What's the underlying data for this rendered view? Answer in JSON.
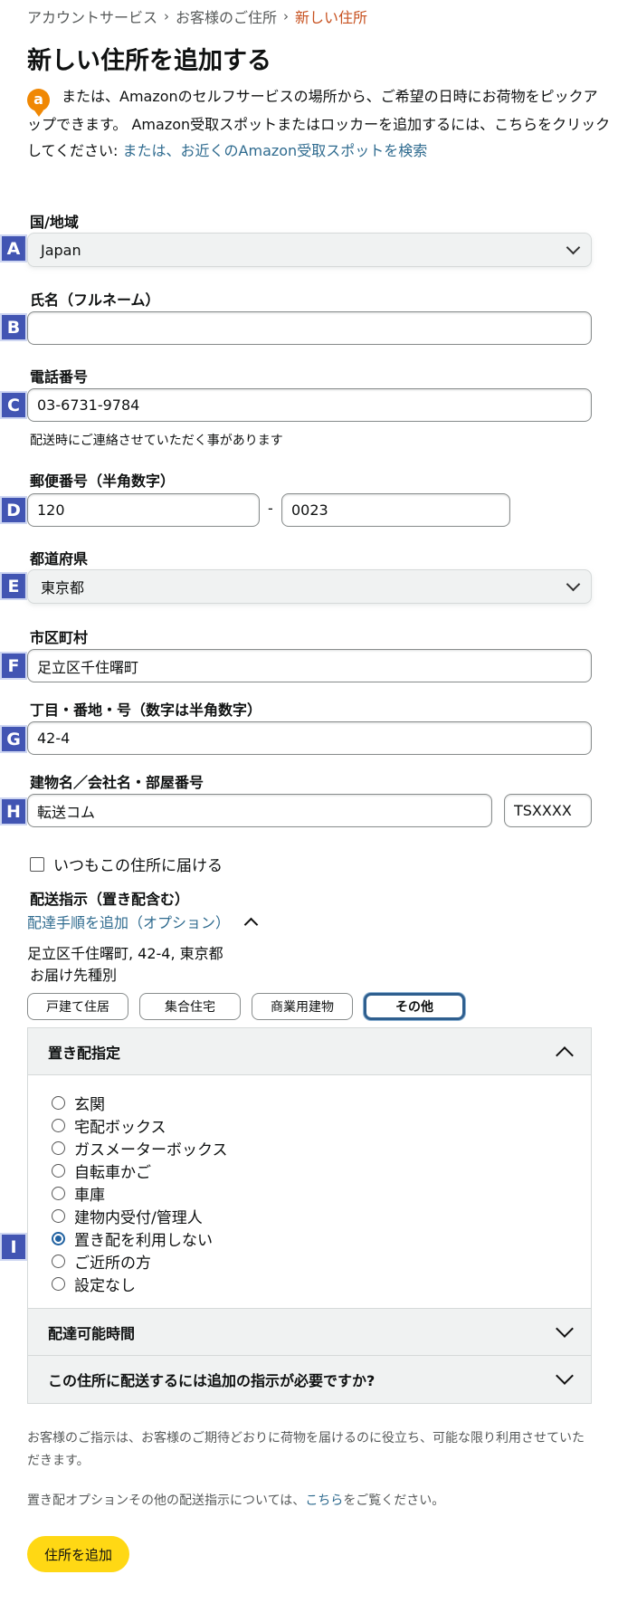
{
  "breadcrumb": {
    "item1": "アカウントサービス",
    "item2": "お客様のご住所",
    "current": "新しい住所",
    "sep": "›"
  },
  "title": "新しい住所を追加する",
  "info": {
    "badge": "a",
    "text": "または、Amazonのセルフサービスの場所から、ご希望の日時にお荷物をピックアップできます。 Amazon受取スポットまたはロッカーを追加するには、こちらをクリックしてください: ",
    "link": "または、お近くのAmazon受取スポットを検索"
  },
  "markers": {
    "a": "A",
    "b": "B",
    "c": "C",
    "d": "D",
    "e": "E",
    "f": "F",
    "g": "G",
    "h": "H",
    "i": "I"
  },
  "country": {
    "label": "国/地域",
    "value": "Japan"
  },
  "fullname": {
    "label": "氏名（フルネーム）",
    "value": ""
  },
  "phone": {
    "label": "電話番号",
    "value": "03-6731-9784",
    "helper": "配送時にご連絡させていただく事があります"
  },
  "postal": {
    "label": "郵便番号（半角数字）",
    "value1": "120",
    "separator": "-",
    "value2": "0023"
  },
  "prefecture": {
    "label": "都道府県",
    "value": "東京都"
  },
  "city": {
    "label": "市区町村",
    "value": "足立区千住曙町"
  },
  "street": {
    "label": "丁目・番地・号（数字は半角数字）",
    "value": "42-4"
  },
  "building": {
    "label": "建物名／会社名・部屋番号",
    "value": "転送コム",
    "room": "TSXXXX"
  },
  "default_checkbox": {
    "label": "いつもこの住所に届ける",
    "checked": false
  },
  "delivery": {
    "label": "配送指示（置き配含む）",
    "add_link": "配達手順を追加（オプション）",
    "address_summary": "足立区千住曙町, 42-4, 東京都",
    "type_label": "お届け先種別",
    "types": [
      "戸建て住居",
      "集合住宅",
      "商業用建物",
      "その他"
    ],
    "selected_type": "その他"
  },
  "accordion": {
    "section1": "置き配指定",
    "options": [
      "玄関",
      "宅配ボックス",
      "ガスメーターボックス",
      "自転車かご",
      "車庫",
      "建物内受付/管理人",
      "置き配を利用しない",
      "ご近所の方",
      "設定なし"
    ],
    "selected_option": "置き配を利用しない",
    "section2": "配達可能時間",
    "section3": "この住所に配送するには追加の指示が必要ですか?"
  },
  "footnote1": "お客様のご指示は、お客様のご期待どおりに荷物を届けるのに役立ち、可能な限り利用させていただきます。",
  "footnote2": {
    "before": "置き配オプションその他の配送指示については、",
    "link": "こちら",
    "after": "をご覧ください。"
  },
  "submit_label": "住所を追加",
  "colors": {
    "accent": "#4255b3",
    "link": "#2f6b8f",
    "button": "#ffd814",
    "breadcrumb_current": "#c7511f"
  }
}
